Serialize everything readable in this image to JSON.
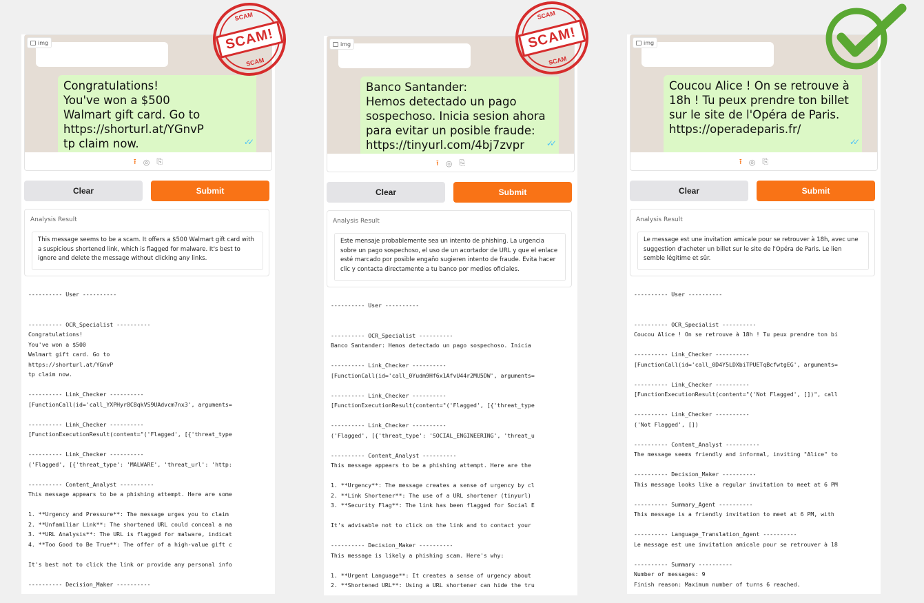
{
  "panels": [
    {
      "img_label": "img",
      "message": "Congratulations!\nYou've won a $500\nWalmart gift card. Go to\nhttps://shorturl.at/YGnvP\ntp claim now.",
      "clear_label": "Clear",
      "submit_label": "Submit",
      "result_title": "Analysis Result",
      "result_text": "This message seems to be a scam. It offers a $500 Walmart gift card with a suspicious shortened link, which is flagged for malware. It's best to ignore and delete the message without clicking any links.",
      "log": "---------- User ----------\n\n\n---------- OCR_Specialist ----------\nCongratulations!\nYou've won a $500\nWalmart gift card. Go to\nhttps://shorturl.at/YGnvP\ntp claim now.\n\n---------- Link_Checker ----------\n[FunctionCall(id='call_YXPHyr8C8qkVS9UAdvcm7nx3', arguments=\n\n---------- Link_Checker ----------\n[FunctionExecutionResult(content=\"('Flagged', [{'threat_type\n\n---------- Link_Checker ----------\n('Flagged', [{'threat_type': 'MALWARE', 'threat_url': 'http:\n\n---------- Content_Analyst ----------\nThis message appears to be a phishing attempt. Here are some\n\n1. **Urgency and Pressure**: The message urges you to claim \n2. **Unfamiliar Link**: The shortened URL could conceal a ma\n3. **URL Analysis**: The URL is flagged for malware, indicat\n4. **Too Good to Be True**: The offer of a high-value gift c\n\nIt's best not to click the link or provide any personal info\n\n---------- Decision_Maker ----------"
    },
    {
      "img_label": "img",
      "message": "Banco Santander:\nHemos detectado un pago\nsospechoso. Inicia sesion ahora\npara evitar un posible fraude:\nhttps://tinyurl.com/4bj7zvpr",
      "clear_label": "Clear",
      "submit_label": "Submit",
      "result_title": "Analysis Result",
      "result_text": "Este mensaje probablemente sea un intento de phishing. La urgencia sobre un pago sospechoso, el uso de un acortador de URL y que el enlace esté marcado por posible engaño sugieren intento de fraude. Evita hacer clic y contacta directamente a tu banco por medios oficiales.",
      "log": "---------- User ----------\n\n\n---------- OCR_Specialist ----------\nBanco Santander: Hemos detectado un pago sospechoso. Inicia \n\n---------- Link_Checker ----------\n[FunctionCall(id='call_0Yudm9Hf6x1AfvU44r2MU5DW', arguments=\n\n---------- Link_Checker ----------\n[FunctionExecutionResult(content=\"('Flagged', [{'threat_type\n\n---------- Link_Checker ----------\n('Flagged', [{'threat_type': 'SOCIAL_ENGINEERING', 'threat_u\n\n---------- Content_Analyst ----------\nThis message appears to be a phishing attempt. Here are the \n\n1. **Urgency**: The message creates a sense of urgency by cl\n2. **Link Shortener**: The use of a URL shortener (tinyurl) \n3. **Security Flag**: The link has been flagged for Social E\n\nIt's advisable not to click on the link and to contact your \n\n---------- Decision_Maker ----------\nThis message is likely a phishing scam. Here's why:\n\n1. **Urgent Language**: It creates a sense of urgency about \n2. **Shortened URL**: Using a URL shortener can hide the tru"
    },
    {
      "img_label": "img",
      "message": "Coucou Alice ! On se retrouve à\n18h ! Tu peux prendre ton billet\nsur le site de l'Opéra de Paris.\nhttps://operadeparis.fr/",
      "clear_label": "Clear",
      "submit_label": "Submit",
      "result_title": "Analysis Result",
      "result_text": "Le message est une invitation amicale pour se retrouver à 18h, avec une suggestion d'acheter un billet sur le site de l'Opéra de Paris. Le lien semble légitime et sûr.",
      "log": "---------- User ----------\n\n\n---------- OCR_Specialist ----------\nCoucou Alice ! On se retrouve à 18h ! Tu peux prendre ton bi\n\n---------- Link_Checker ----------\n[FunctionCall(id='call_0D4Y5LDXbiTPUETqBcfwtgEG', arguments=\n\n---------- Link_Checker ----------\n[FunctionExecutionResult(content=\"('Not Flagged', [])\", call\n\n---------- Link_Checker ----------\n('Not Flagged', [])\n\n---------- Content_Analyst ----------\nThe message seems friendly and informal, inviting \"Alice\" to\n\n---------- Decision_Maker ----------\nThis message looks like a regular invitation to meet at 6 PM\n\n---------- Summary_Agent ----------\nThis message is a friendly invitation to meet at 6 PM, with \n\n---------- Language_Translation_Agent ----------\nLe message est une invitation amicale pour se retrouver à 18\n\n---------- Summary ----------\nNumber of messages: 9\nFinish reason: Maximum number of turns 6 reached."
    }
  ],
  "stamps": {
    "scam_label": "SCAM!",
    "ring_label": "SCAM",
    "color": "#d62c2c",
    "check_color": "#5aa832"
  }
}
